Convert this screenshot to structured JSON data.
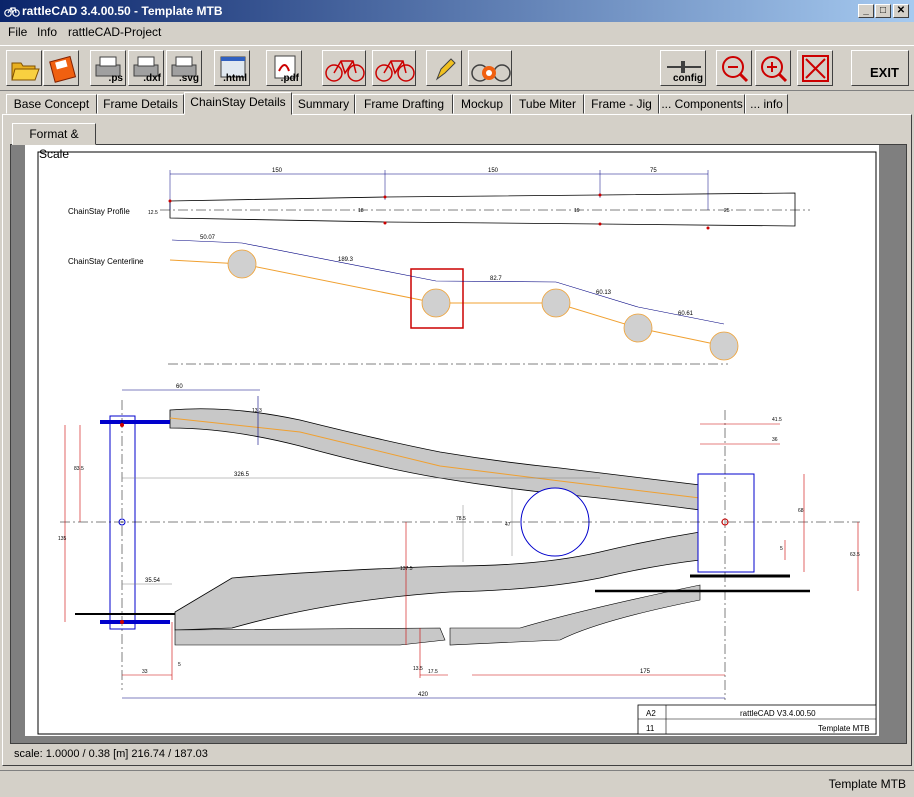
{
  "window": {
    "title": "rattleCAD  3.4.00.50 - Template MTB",
    "minimize": "_",
    "maximize": "□",
    "close": "✕"
  },
  "menu": [
    {
      "label": "File"
    },
    {
      "label": "Info"
    },
    {
      "label": "rattleCAD-Project"
    }
  ],
  "toolbar": {
    "open_icon": "folder-open-icon",
    "save_icon": "save-icon",
    "ps_label": ".ps",
    "dxf_label": ".dxf",
    "svg_label": ".svg",
    "html_label": ".html",
    "pdf_label": ".pdf",
    "config_label": "config",
    "exit_label": "EXIT"
  },
  "tabs": [
    {
      "label": "Base Concept"
    },
    {
      "label": "Frame Details"
    },
    {
      "label": "ChainStay Details",
      "active": true
    },
    {
      "label": "Summary"
    },
    {
      "label": "Frame Drafting"
    },
    {
      "label": "Mockup"
    },
    {
      "label": "Tube Miter"
    },
    {
      "label": "Frame - Jig"
    },
    {
      "label": "... Components"
    },
    {
      "label": "... info"
    }
  ],
  "subtab": {
    "label": "Format & Scale"
  },
  "drawing": {
    "profile_label": "ChainStay Profile",
    "centerline_label": "ChainStay Centerline",
    "dim_150a": "150",
    "dim_150b": "150",
    "dim_75": "75",
    "dim_prof_left": "12.5",
    "dim_prof_1": "18",
    "dim_prof_2": "19",
    "dim_prof_right": "25",
    "cl_dim_1": "50.07",
    "cl_dim_2": "189.3",
    "cl_dim_3": "82.7",
    "cl_dim_4": "60.13",
    "cl_dim_5": "60.61",
    "top_dim_60": "60",
    "top_dim_13": "13.3",
    "dim_3265": "326.5",
    "dim_785": "78.5",
    "dim_47": "47",
    "dim_3554": "35.54",
    "dim_415": "41.5",
    "dim_36": "36",
    "dim_68": "68",
    "dim_635": "63.5",
    "dim_5": "5",
    "dim_135": "135",
    "dim_1375": "137.5",
    "dim_835": "83.5",
    "dim_33": "33",
    "dim_5b": "5",
    "dim_135b": "13.5",
    "dim_175": "17.5",
    "dim_175b": "175",
    "dim_420": "420",
    "title_block": {
      "sheet": "A2",
      "app": "rattleCAD  V3.4.00.50",
      "num": "11",
      "name": "Template MTB"
    }
  },
  "status": {
    "scale_line": "scale: 1.0000 / 0.38  [m]  216.74 / 187.03",
    "right": "Template MTB"
  },
  "colors": {
    "title_start": "#0a246a",
    "title_end": "#a6caf0",
    "orange": "#f0a030",
    "blue": "#0000cc",
    "dim": "#000080",
    "red": "#cc0000"
  }
}
